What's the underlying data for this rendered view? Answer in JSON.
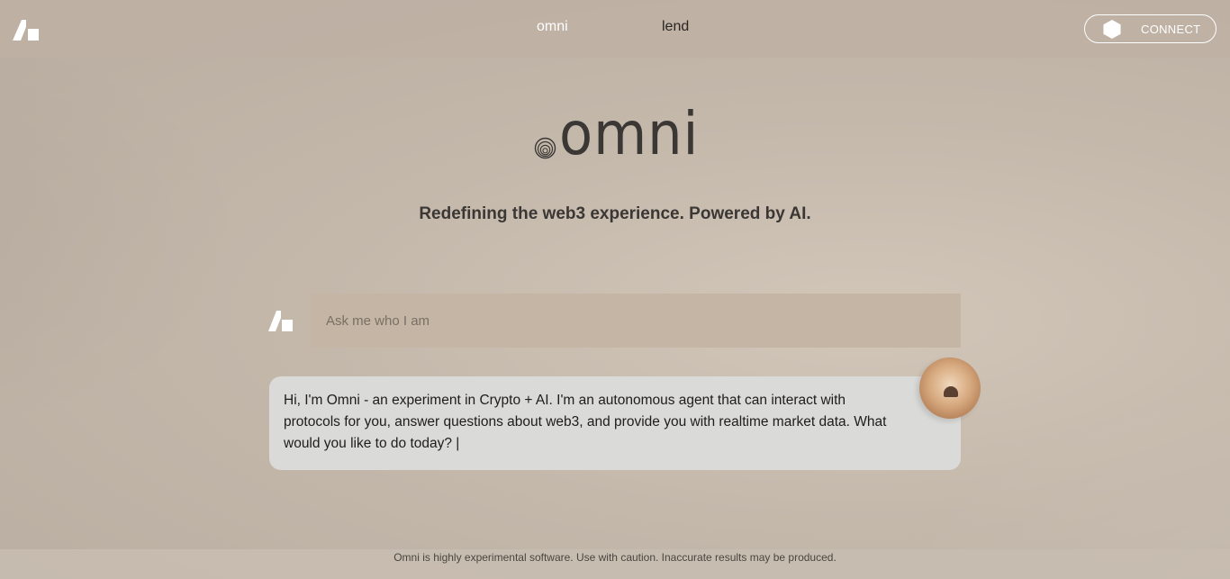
{
  "header": {
    "nav": [
      {
        "label": "omni",
        "active": true
      },
      {
        "label": "lend",
        "active": false
      }
    ],
    "connect_label": "CONNECT",
    "brand_icon": "brand-logo-icon",
    "wallet_icon": "hexagon-icon"
  },
  "hero": {
    "wordmark": "omni",
    "tagline": "Redefining the web3 experience. Powered by AI."
  },
  "chat": {
    "input_placeholder": "Ask me who I am",
    "input_value": "",
    "message": "Hi, I'm Omni - an experiment in Crypto + AI. I'm an autonomous agent that can interact with protocols for you, answer questions about web3, and provide you with realtime market data. What would you like to do today? |"
  },
  "footer": {
    "disclaimer": "Omni is highly experimental software. Use with caution. Inaccurate results may be produced."
  },
  "colors": {
    "background": "#c4b8ab",
    "input_bg": "#c4b5a4",
    "bubble_bg": "#dadad9",
    "text_dark": "#3a3734"
  }
}
